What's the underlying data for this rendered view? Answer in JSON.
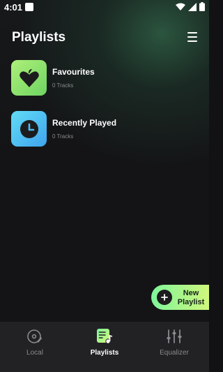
{
  "status_bar": {
    "time": "4:01"
  },
  "header": {
    "title": "Playlists",
    "menu_icon": "hamburger-menu-icon"
  },
  "playlists": [
    {
      "title": "Favourites",
      "count": "0 Tracks",
      "icon": "heart-icon",
      "color": "#8ee36e"
    },
    {
      "title": "Recently Played",
      "count": "0 Tracks",
      "icon": "clock-icon",
      "color": "#4bbcf2"
    }
  ],
  "fab": {
    "label_line1": "New",
    "label_line2": "Playlist",
    "icon": "plus-icon"
  },
  "bottom_nav": {
    "items": [
      {
        "label": "Local",
        "icon": "disc-icon",
        "active": false
      },
      {
        "label": "Playlists",
        "icon": "playlist-icon",
        "active": true
      },
      {
        "label": "Equalizer",
        "icon": "equalizer-icon",
        "active": false
      }
    ]
  },
  "colors": {
    "accent_green": "#7ff59a",
    "accent_lime": "#d6f77a",
    "background": "#141416",
    "nav_background": "#222225"
  }
}
